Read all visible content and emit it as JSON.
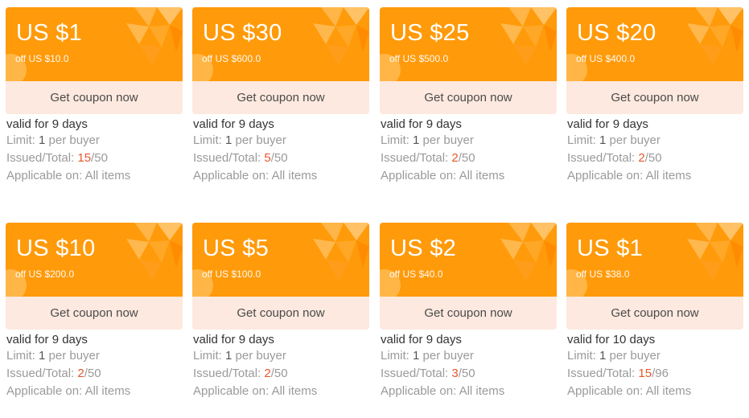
{
  "coupons": [
    {
      "amount": "US $1",
      "off": "off US $10.0",
      "button": "Get coupon now",
      "valid": "valid for 9 days",
      "limit_prefix": "Limit: ",
      "limit_num": "1",
      "limit_suffix": " per buyer",
      "issued_prefix": "Issued/Total: ",
      "issued": "15",
      "total": "/50",
      "applicable": "Applicable on: All items"
    },
    {
      "amount": "US $30",
      "off": "off US $600.0",
      "button": "Get coupon now",
      "valid": "valid for 9 days",
      "limit_prefix": "Limit: ",
      "limit_num": "1",
      "limit_suffix": " per buyer",
      "issued_prefix": "Issued/Total: ",
      "issued": "5",
      "total": "/50",
      "applicable": "Applicable on: All items"
    },
    {
      "amount": "US $25",
      "off": "off US $500.0",
      "button": "Get coupon now",
      "valid": "valid for 9 days",
      "limit_prefix": "Limit: ",
      "limit_num": "1",
      "limit_suffix": " per buyer",
      "issued_prefix": "Issued/Total: ",
      "issued": "2",
      "total": "/50",
      "applicable": "Applicable on: All items"
    },
    {
      "amount": "US $20",
      "off": "off US $400.0",
      "button": "Get coupon now",
      "valid": "valid for 9 days",
      "limit_prefix": "Limit: ",
      "limit_num": "1",
      "limit_suffix": " per buyer",
      "issued_prefix": "Issued/Total: ",
      "issued": "2",
      "total": "/50",
      "applicable": "Applicable on: All items"
    },
    {
      "amount": "US $10",
      "off": "off US $200.0",
      "button": "Get coupon now",
      "valid": "valid for 9 days",
      "limit_prefix": "Limit: ",
      "limit_num": "1",
      "limit_suffix": " per buyer",
      "issued_prefix": "Issued/Total: ",
      "issued": "2",
      "total": "/50",
      "applicable": "Applicable on: All items"
    },
    {
      "amount": "US $5",
      "off": "off US $100.0",
      "button": "Get coupon now",
      "valid": "valid for 9 days",
      "limit_prefix": "Limit: ",
      "limit_num": "1",
      "limit_suffix": " per buyer",
      "issued_prefix": "Issued/Total: ",
      "issued": "2",
      "total": "/50",
      "applicable": "Applicable on: All items"
    },
    {
      "amount": "US $2",
      "off": "off US $40.0",
      "button": "Get coupon now",
      "valid": "valid for 9 days",
      "limit_prefix": "Limit: ",
      "limit_num": "1",
      "limit_suffix": " per buyer",
      "issued_prefix": "Issued/Total: ",
      "issued": "3",
      "total": "/50",
      "applicable": "Applicable on: All items"
    },
    {
      "amount": "US $1",
      "off": "off US $38.0",
      "button": "Get coupon now",
      "valid": "valid for 10 days",
      "limit_prefix": "Limit: ",
      "limit_num": "1",
      "limit_suffix": " per buyer",
      "issued_prefix": "Issued/Total: ",
      "issued": "15",
      "total": "/96",
      "applicable": "Applicable on: All items"
    }
  ],
  "colors": {
    "coupon_orange": "#ff9a0a",
    "button_bg": "#fde9df",
    "issued_highlight": "#e8562b"
  },
  "icons": {
    "corner_decoration": "abstract-leaf-pattern"
  }
}
